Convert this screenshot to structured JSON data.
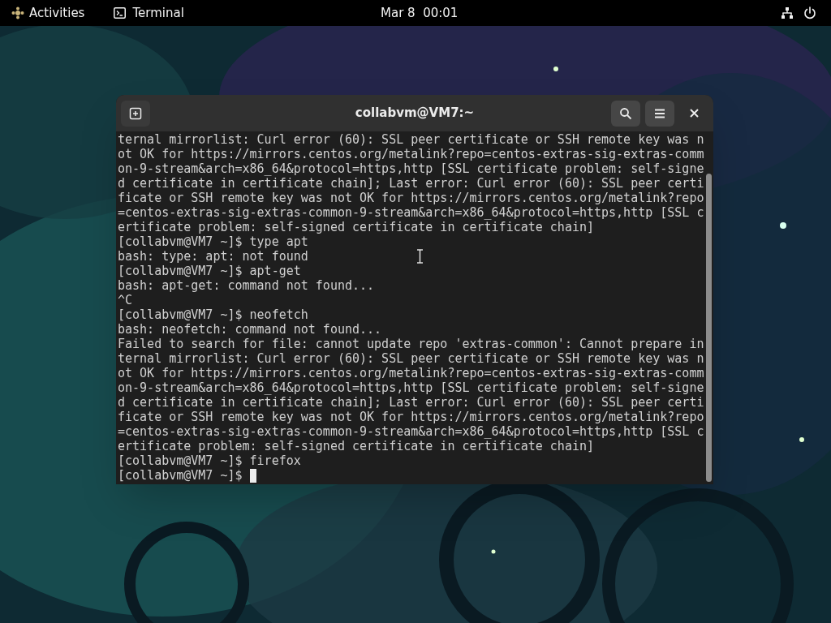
{
  "top_bar": {
    "activities": "Activities",
    "app_menu": "Terminal",
    "clock": "Mar 8  00:01"
  },
  "window": {
    "title": "collabvm@VM7:~",
    "lines": [
      "ternal mirrorlist: Curl error (60): SSL peer certificate or SSH remote key was n",
      "ot OK for https://mirrors.centos.org/metalink?repo=centos-extras-sig-extras-comm",
      "on-9-stream&arch=x86_64&protocol=https,http [SSL certificate problem: self-signe",
      "d certificate in certificate chain]; Last error: Curl error (60): SSL peer certi",
      "ficate or SSH remote key was not OK for https://mirrors.centos.org/metalink?repo",
      "=centos-extras-sig-extras-common-9-stream&arch=x86_64&protocol=https,http [SSL c",
      "ertificate problem: self-signed certificate in certificate chain]",
      "[collabvm@VM7 ~]$ type apt",
      "bash: type: apt: not found",
      "[collabvm@VM7 ~]$ apt-get",
      "bash: apt-get: command not found...",
      "^C",
      "[collabvm@VM7 ~]$ neofetch",
      "bash: neofetch: command not found...",
      "Failed to search for file: cannot update repo 'extras-common': Cannot prepare in",
      "ternal mirrorlist: Curl error (60): SSL peer certificate or SSH remote key was n",
      "ot OK for https://mirrors.centos.org/metalink?repo=centos-extras-sig-extras-comm",
      "on-9-stream&arch=x86_64&protocol=https,http [SSL certificate problem: self-signe",
      "d certificate in certificate chain]; Last error: Curl error (60): SSL peer certi",
      "ficate or SSH remote key was not OK for https://mirrors.centos.org/metalink?repo",
      "=centos-extras-sig-extras-common-9-stream&arch=x86_64&protocol=https,http [SSL c",
      "ertificate problem: self-signed certificate in certificate chain]",
      "[collabvm@VM7 ~]$ firefox"
    ],
    "prompt": "[collabvm@VM7 ~]$"
  }
}
